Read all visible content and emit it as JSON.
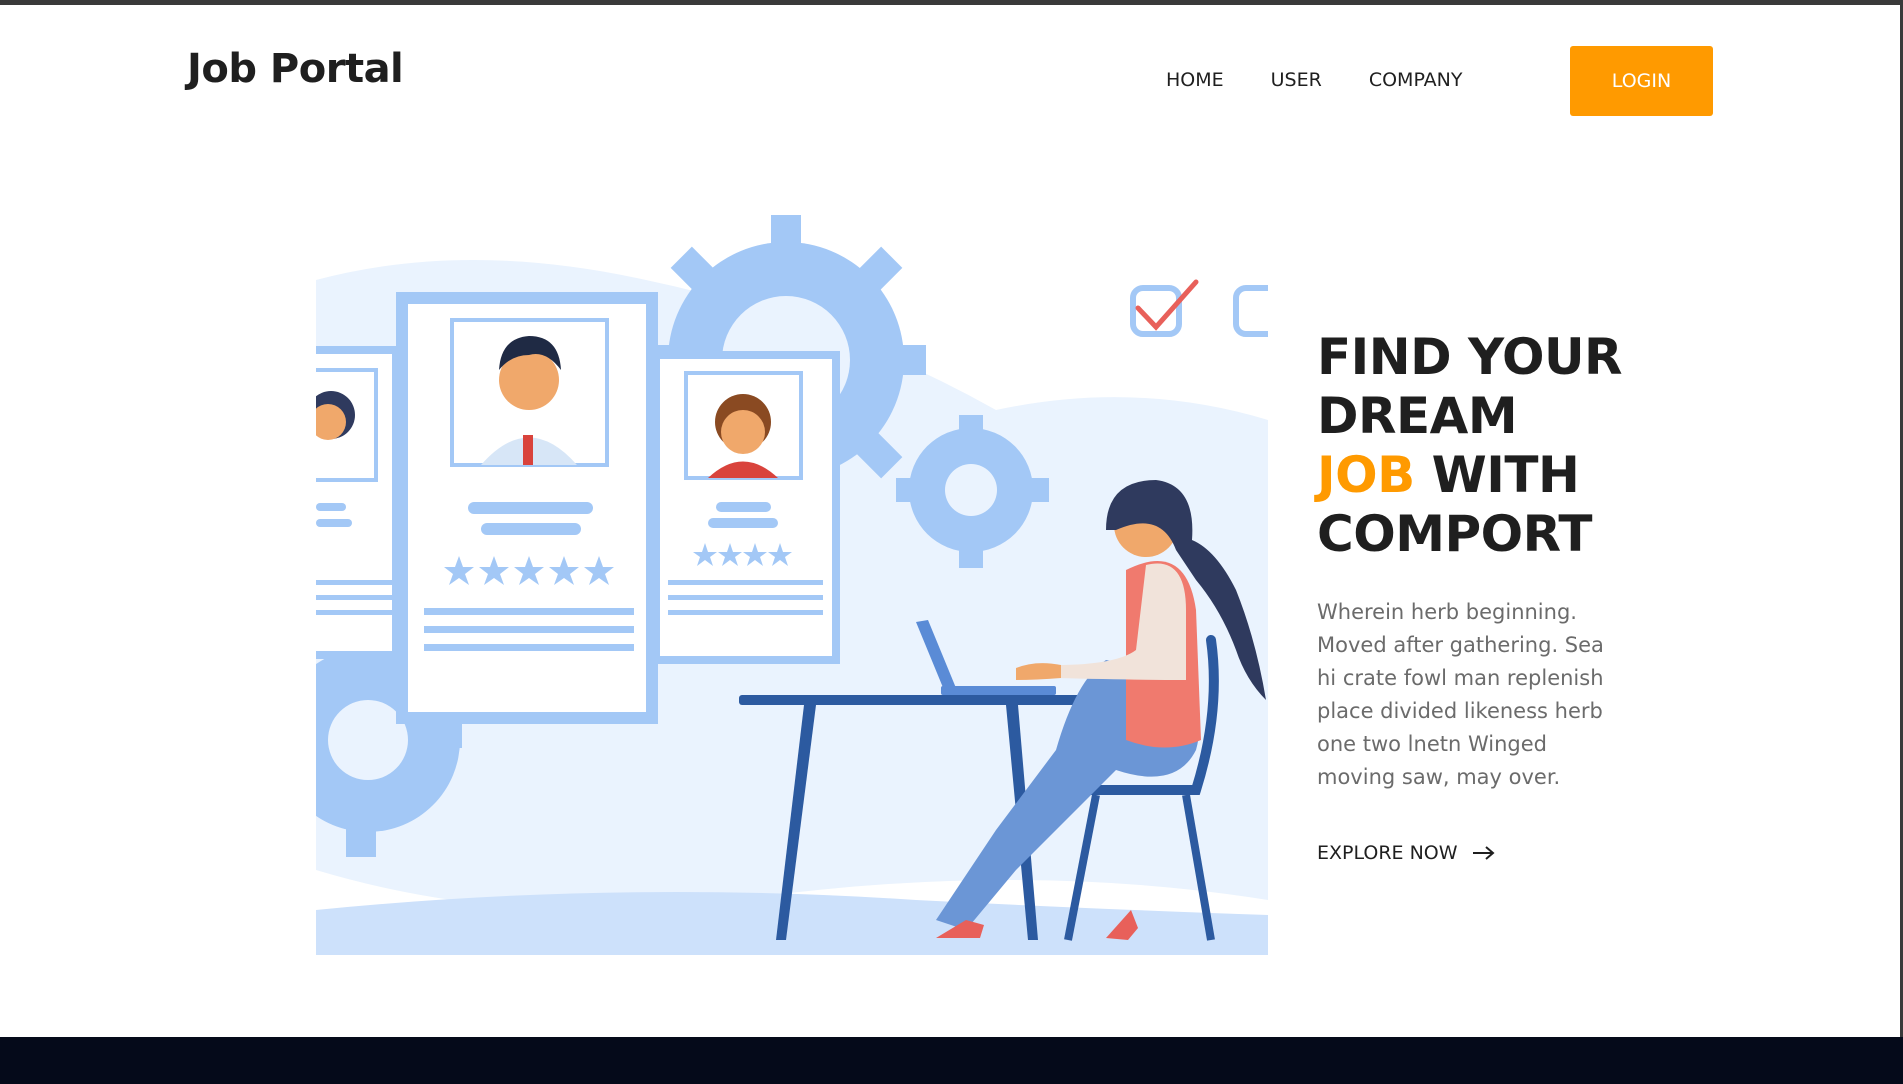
{
  "brand": {
    "logo": "Job Portal"
  },
  "nav": {
    "items": [
      {
        "label": "HOME"
      },
      {
        "label": "USER"
      },
      {
        "label": "COMPANY"
      }
    ],
    "login_label": "LOGIN"
  },
  "hero": {
    "title_line1": "FIND YOUR",
    "title_line2": "DREAM",
    "title_accent": "JOB",
    "title_line3_rest": " WITH",
    "title_line4": "COMPORT",
    "description": "Wherein herb beginning. Moved after gathering. Sea hi crate fowl man replenish place divided likeness herb one two lnetn Winged moving saw, may over.",
    "cta_label": "EXPLORE NOW"
  },
  "colors": {
    "accent": "#ff9a00",
    "text_dark": "#1f1f1f",
    "text_muted": "#6b6b6b",
    "illustration_blue": "#a3c8f6",
    "footer": "#050a1a"
  },
  "icons": {
    "cta_icon": "arrow-right-icon",
    "illustration": "recruiter-at-laptop-illustration"
  }
}
